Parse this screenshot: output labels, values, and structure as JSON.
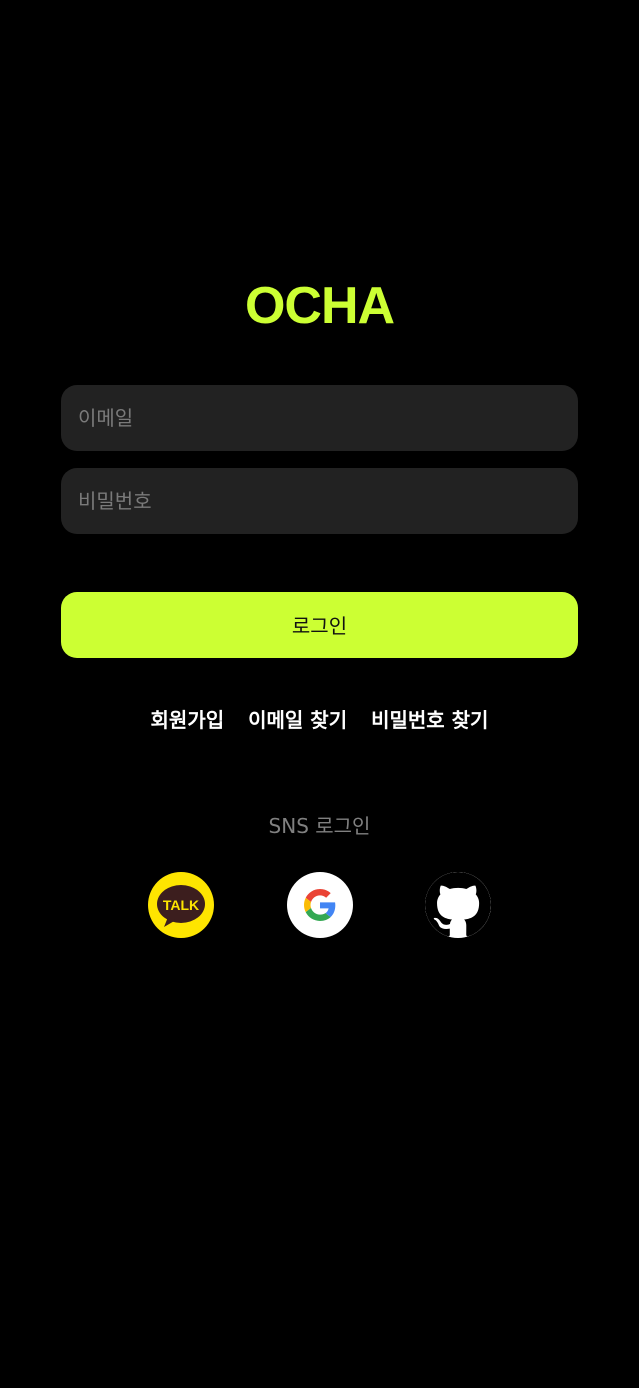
{
  "app": {
    "logo": "OCHA",
    "accent_color": "#CCFF33"
  },
  "form": {
    "email_placeholder": "이메일",
    "email_value": "",
    "password_placeholder": "비밀번호",
    "password_value": "",
    "login_label": "로그인"
  },
  "links": {
    "signup": "회원가입",
    "find_email": "이메일 찾기",
    "find_password": "비밀번호 찾기"
  },
  "sns": {
    "title": "SNS 로그인",
    "kakao_icon_text": "TALK",
    "providers": [
      {
        "name": "kakao",
        "icon": "kakao-talk-icon",
        "color": "#FEE500"
      },
      {
        "name": "google",
        "icon": "google-icon",
        "color": "#FFFFFF"
      },
      {
        "name": "github",
        "icon": "github-icon",
        "color": "#FFFFFF"
      }
    ]
  }
}
